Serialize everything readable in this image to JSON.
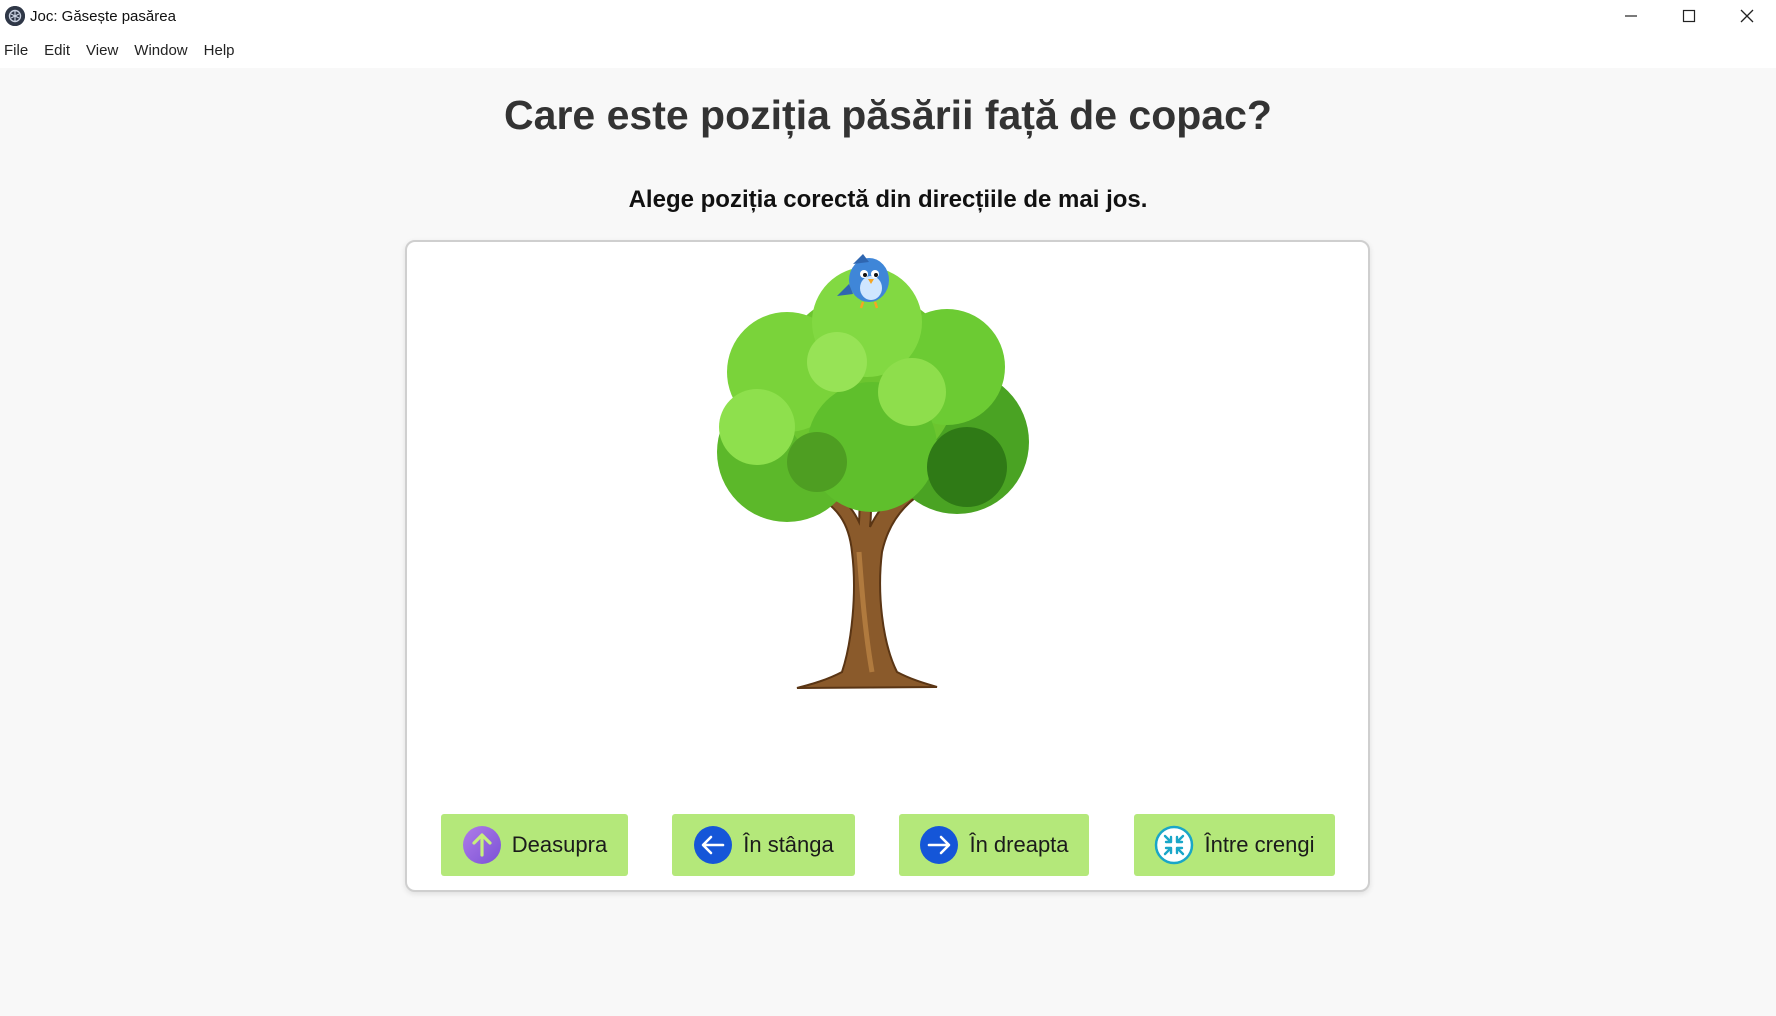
{
  "window": {
    "title": "Joc: Găsește pasărea",
    "controls": [
      "minimize",
      "maximize",
      "close"
    ]
  },
  "menu": {
    "items": [
      "File",
      "Edit",
      "View",
      "Window",
      "Help"
    ]
  },
  "game": {
    "question": "Care este poziția păsării față de copac?",
    "instruction": "Alege poziția corectă din direcțiile de mai jos.",
    "scene": {
      "bird": "bird-on-top-of-tree",
      "tree": "tree"
    },
    "answers": [
      {
        "label": "Deasupra",
        "icon": "arrow-up-icon",
        "color": "#9a6de0"
      },
      {
        "label": "În stânga",
        "icon": "arrow-left-icon",
        "color": "#1556d8"
      },
      {
        "label": "În dreapta",
        "icon": "arrow-right-icon",
        "color": "#1556d8"
      },
      {
        "label": "Între crengi",
        "icon": "compress-icon",
        "color": "#19a6c8"
      }
    ]
  },
  "colors": {
    "button_bg": "#b4e87a",
    "page_bg": "#f8f8f8",
    "card_bg": "#ffffff"
  }
}
